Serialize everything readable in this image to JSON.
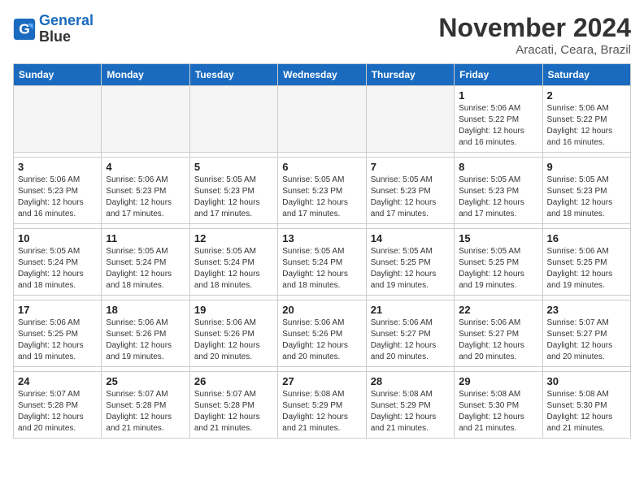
{
  "logo": {
    "line1": "General",
    "line2": "Blue"
  },
  "title": "November 2024",
  "location": "Aracati, Ceara, Brazil",
  "headers": [
    "Sunday",
    "Monday",
    "Tuesday",
    "Wednesday",
    "Thursday",
    "Friday",
    "Saturday"
  ],
  "weeks": [
    [
      {
        "day": "",
        "info": ""
      },
      {
        "day": "",
        "info": ""
      },
      {
        "day": "",
        "info": ""
      },
      {
        "day": "",
        "info": ""
      },
      {
        "day": "",
        "info": ""
      },
      {
        "day": "1",
        "info": "Sunrise: 5:06 AM\nSunset: 5:22 PM\nDaylight: 12 hours\nand 16 minutes."
      },
      {
        "day": "2",
        "info": "Sunrise: 5:06 AM\nSunset: 5:22 PM\nDaylight: 12 hours\nand 16 minutes."
      }
    ],
    [
      {
        "day": "3",
        "info": "Sunrise: 5:06 AM\nSunset: 5:23 PM\nDaylight: 12 hours\nand 16 minutes."
      },
      {
        "day": "4",
        "info": "Sunrise: 5:06 AM\nSunset: 5:23 PM\nDaylight: 12 hours\nand 17 minutes."
      },
      {
        "day": "5",
        "info": "Sunrise: 5:05 AM\nSunset: 5:23 PM\nDaylight: 12 hours\nand 17 minutes."
      },
      {
        "day": "6",
        "info": "Sunrise: 5:05 AM\nSunset: 5:23 PM\nDaylight: 12 hours\nand 17 minutes."
      },
      {
        "day": "7",
        "info": "Sunrise: 5:05 AM\nSunset: 5:23 PM\nDaylight: 12 hours\nand 17 minutes."
      },
      {
        "day": "8",
        "info": "Sunrise: 5:05 AM\nSunset: 5:23 PM\nDaylight: 12 hours\nand 17 minutes."
      },
      {
        "day": "9",
        "info": "Sunrise: 5:05 AM\nSunset: 5:23 PM\nDaylight: 12 hours\nand 18 minutes."
      }
    ],
    [
      {
        "day": "10",
        "info": "Sunrise: 5:05 AM\nSunset: 5:24 PM\nDaylight: 12 hours\nand 18 minutes."
      },
      {
        "day": "11",
        "info": "Sunrise: 5:05 AM\nSunset: 5:24 PM\nDaylight: 12 hours\nand 18 minutes."
      },
      {
        "day": "12",
        "info": "Sunrise: 5:05 AM\nSunset: 5:24 PM\nDaylight: 12 hours\nand 18 minutes."
      },
      {
        "day": "13",
        "info": "Sunrise: 5:05 AM\nSunset: 5:24 PM\nDaylight: 12 hours\nand 18 minutes."
      },
      {
        "day": "14",
        "info": "Sunrise: 5:05 AM\nSunset: 5:25 PM\nDaylight: 12 hours\nand 19 minutes."
      },
      {
        "day": "15",
        "info": "Sunrise: 5:05 AM\nSunset: 5:25 PM\nDaylight: 12 hours\nand 19 minutes."
      },
      {
        "day": "16",
        "info": "Sunrise: 5:06 AM\nSunset: 5:25 PM\nDaylight: 12 hours\nand 19 minutes."
      }
    ],
    [
      {
        "day": "17",
        "info": "Sunrise: 5:06 AM\nSunset: 5:25 PM\nDaylight: 12 hours\nand 19 minutes."
      },
      {
        "day": "18",
        "info": "Sunrise: 5:06 AM\nSunset: 5:26 PM\nDaylight: 12 hours\nand 19 minutes."
      },
      {
        "day": "19",
        "info": "Sunrise: 5:06 AM\nSunset: 5:26 PM\nDaylight: 12 hours\nand 20 minutes."
      },
      {
        "day": "20",
        "info": "Sunrise: 5:06 AM\nSunset: 5:26 PM\nDaylight: 12 hours\nand 20 minutes."
      },
      {
        "day": "21",
        "info": "Sunrise: 5:06 AM\nSunset: 5:27 PM\nDaylight: 12 hours\nand 20 minutes."
      },
      {
        "day": "22",
        "info": "Sunrise: 5:06 AM\nSunset: 5:27 PM\nDaylight: 12 hours\nand 20 minutes."
      },
      {
        "day": "23",
        "info": "Sunrise: 5:07 AM\nSunset: 5:27 PM\nDaylight: 12 hours\nand 20 minutes."
      }
    ],
    [
      {
        "day": "24",
        "info": "Sunrise: 5:07 AM\nSunset: 5:28 PM\nDaylight: 12 hours\nand 20 minutes."
      },
      {
        "day": "25",
        "info": "Sunrise: 5:07 AM\nSunset: 5:28 PM\nDaylight: 12 hours\nand 21 minutes."
      },
      {
        "day": "26",
        "info": "Sunrise: 5:07 AM\nSunset: 5:28 PM\nDaylight: 12 hours\nand 21 minutes."
      },
      {
        "day": "27",
        "info": "Sunrise: 5:08 AM\nSunset: 5:29 PM\nDaylight: 12 hours\nand 21 minutes."
      },
      {
        "day": "28",
        "info": "Sunrise: 5:08 AM\nSunset: 5:29 PM\nDaylight: 12 hours\nand 21 minutes."
      },
      {
        "day": "29",
        "info": "Sunrise: 5:08 AM\nSunset: 5:30 PM\nDaylight: 12 hours\nand 21 minutes."
      },
      {
        "day": "30",
        "info": "Sunrise: 5:08 AM\nSunset: 5:30 PM\nDaylight: 12 hours\nand 21 minutes."
      }
    ]
  ]
}
